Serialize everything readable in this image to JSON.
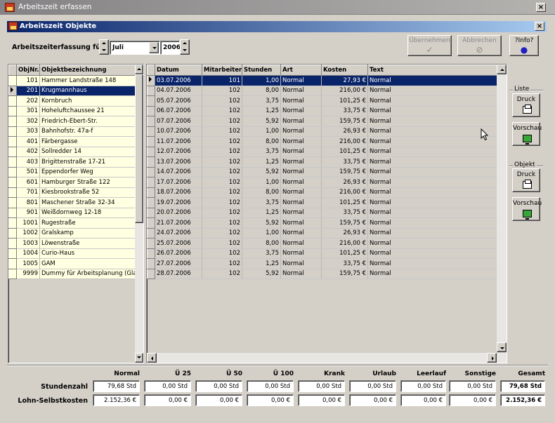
{
  "window": {
    "title": "Arbeitszeit erfassen",
    "close": "×"
  },
  "child": {
    "title": "Arbeitszeit Objekte",
    "close": "×"
  },
  "filter": {
    "label": "Arbeitszeiterfassung für",
    "month": "Juli",
    "year": "2006"
  },
  "toolbar": {
    "apply": {
      "label": "Übernehmen",
      "glyph": "✓"
    },
    "cancel": {
      "label": "Abbrechen",
      "glyph": "⊘"
    },
    "info": {
      "label": "?Info?",
      "glyph": "●"
    }
  },
  "objects": {
    "headers": [
      "ObjNr.",
      "Objektbezeichnung"
    ],
    "rows": [
      [
        "101",
        "Hammer Landstraße 148"
      ],
      [
        "201",
        "Krugmannhaus"
      ],
      [
        "202",
        "Kornbruch"
      ],
      [
        "301",
        "Hoheluftchaussee 21"
      ],
      [
        "302",
        "Friedrich-Ebert-Str."
      ],
      [
        "303",
        "Bahnhofstr. 47a-f"
      ],
      [
        "401",
        "Färbergasse"
      ],
      [
        "402",
        "Sollredder 14"
      ],
      [
        "403",
        "Brigittenstraße 17-21"
      ],
      [
        "501",
        "Eppendorfer Weg"
      ],
      [
        "601",
        "Hamburger Straße 122"
      ],
      [
        "701",
        "Kiesbrookstraße 52"
      ],
      [
        "801",
        "Maschener Straße 32-34"
      ],
      [
        "901",
        "Weißdornweg 12-18"
      ],
      [
        "1001",
        "Rugestraße"
      ],
      [
        "1002",
        "Gralskamp"
      ],
      [
        "1003",
        "Löwenstraße"
      ],
      [
        "1004",
        "Curio-Haus"
      ],
      [
        "1005",
        "GAM"
      ],
      [
        "9999",
        "Dummy für Arbeitsplanung (Glasr"
      ]
    ],
    "selected_index": 1
  },
  "entries": {
    "headers": [
      "Datum",
      "Mitarbeiter",
      "Stunden",
      "Art",
      "Kosten",
      "Text"
    ],
    "rows": [
      [
        "03.07.2006",
        "101",
        "1,00",
        "Normal",
        "27,93 €",
        "Normal"
      ],
      [
        "04.07.2006",
        "102",
        "8,00",
        "Normal",
        "216,00 €",
        "Normal"
      ],
      [
        "05.07.2006",
        "102",
        "3,75",
        "Normal",
        "101,25 €",
        "Normal"
      ],
      [
        "06.07.2006",
        "102",
        "1,25",
        "Normal",
        "33,75 €",
        "Normal"
      ],
      [
        "07.07.2006",
        "102",
        "5,92",
        "Normal",
        "159,75 €",
        "Normal"
      ],
      [
        "10.07.2006",
        "102",
        "1,00",
        "Normal",
        "26,93 €",
        "Normal"
      ],
      [
        "11.07.2006",
        "102",
        "8,00",
        "Normal",
        "216,00 €",
        "Normal"
      ],
      [
        "12.07.2006",
        "102",
        "3,75",
        "Normal",
        "101,25 €",
        "Normal"
      ],
      [
        "13.07.2006",
        "102",
        "1,25",
        "Normal",
        "33,75 €",
        "Normal"
      ],
      [
        "14.07.2006",
        "102",
        "5,92",
        "Normal",
        "159,75 €",
        "Normal"
      ],
      [
        "17.07.2006",
        "102",
        "1,00",
        "Normal",
        "26,93 €",
        "Normal"
      ],
      [
        "18.07.2006",
        "102",
        "8,00",
        "Normal",
        "216,00 €",
        "Normal"
      ],
      [
        "19.07.2006",
        "102",
        "3,75",
        "Normal",
        "101,25 €",
        "Normal"
      ],
      [
        "20.07.2006",
        "102",
        "1,25",
        "Normal",
        "33,75 €",
        "Normal"
      ],
      [
        "21.07.2006",
        "102",
        "5,92",
        "Normal",
        "159,75 €",
        "Normal"
      ],
      [
        "24.07.2006",
        "102",
        "1,00",
        "Normal",
        "26,93 €",
        "Normal"
      ],
      [
        "25.07.2006",
        "102",
        "8,00",
        "Normal",
        "216,00 €",
        "Normal"
      ],
      [
        "26.07.2006",
        "102",
        "3,75",
        "Normal",
        "101,25 €",
        "Normal"
      ],
      [
        "27.07.2006",
        "102",
        "1,25",
        "Normal",
        "33,75 €",
        "Normal"
      ],
      [
        "28.07.2006",
        "102",
        "5,92",
        "Normal",
        "159,75 €",
        "Normal"
      ]
    ],
    "selected_index": 0
  },
  "side": {
    "list_group": "Liste",
    "object_group": "Objekt",
    "print": "Druck",
    "preview": "Vorschau"
  },
  "summary": {
    "columns": [
      "Normal",
      "Ü 25",
      "Ü 50",
      "Ü 100",
      "Krank",
      "Urlaub",
      "Leerlauf",
      "Sonstige",
      "Gesamt"
    ],
    "row_labels": [
      "Stundenzahl",
      "Lohn-Selbstkosten"
    ],
    "hours": [
      "79,68 Std",
      "0,00 Std",
      "0,00 Std",
      "0,00 Std",
      "0,00 Std",
      "0,00 Std",
      "0,00 Std",
      "0,00 Std",
      "79,68 Std"
    ],
    "costs": [
      "2.152,36 €",
      "0,00 €",
      "0,00 €",
      "0,00 €",
      "0,00 €",
      "0,00 €",
      "0,00 €",
      "0,00 €",
      "2.152,36 €"
    ]
  }
}
